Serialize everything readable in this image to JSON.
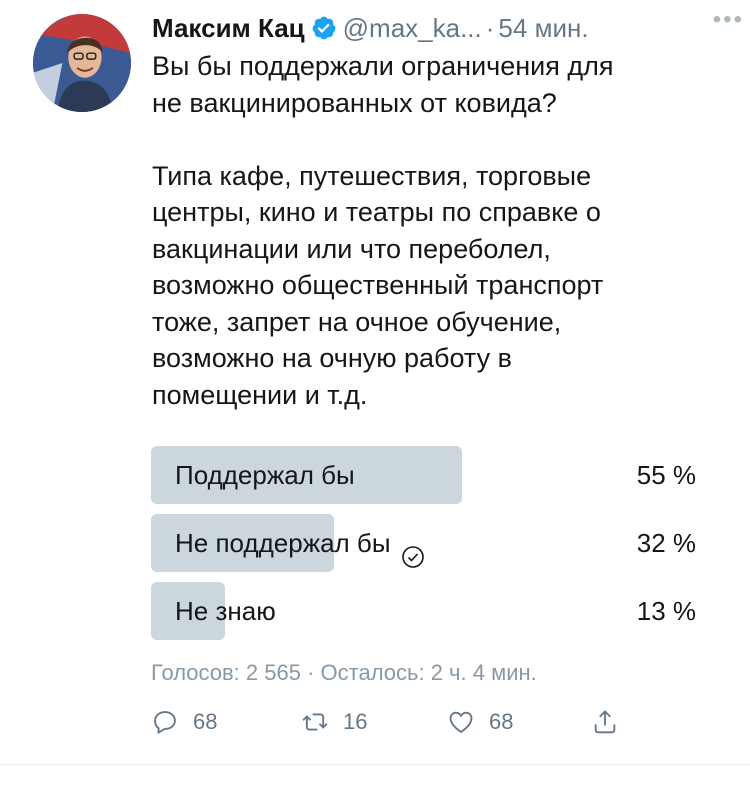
{
  "author": {
    "name": "Максим Кац",
    "handle": "@max_ka...",
    "time": "54 мин."
  },
  "tweet": {
    "text": "Вы бы поддержали ограничения для\nне вакцинированных от ковида?\n\nТипа кафе, путешествия, торговые\nцентры, кино и театры по справке о\nвакцинации или что переболел,\nвозможно общественный транспорт\nтоже, запрет на очное обучение,\nвозможно на очную работу в\nпомещении и т.д."
  },
  "poll": {
    "options": [
      {
        "label": "Поддержал бы",
        "percent_text": "55 %",
        "percent": 55,
        "selected": false
      },
      {
        "label": "Не поддержал бы",
        "percent_text": "32 %",
        "percent": 32,
        "selected": true
      },
      {
        "label": "Не знаю",
        "percent_text": "13 %",
        "percent": 13,
        "selected": false
      }
    ],
    "meta": "Голосов: 2 565 · Осталось: 2 ч. 4 мин."
  },
  "actions": {
    "replies": "68",
    "retweets": "16",
    "likes": "68"
  },
  "icons": {
    "verified": "verified-badge-icon",
    "more": "more-icon",
    "reply": "reply-icon",
    "retweet": "retweet-icon",
    "like": "heart-icon",
    "share": "share-icon",
    "check": "check-circle-icon"
  },
  "colors": {
    "verified": "#1da1f2",
    "poll_bar": "#ccd6dd",
    "secondary_text": "#657786"
  }
}
